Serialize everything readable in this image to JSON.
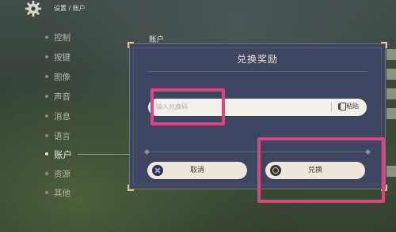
{
  "breadcrumb": "设置 / 账户",
  "menu": [
    {
      "label": "控制",
      "active": false
    },
    {
      "label": "按键",
      "active": false
    },
    {
      "label": "图像",
      "active": false
    },
    {
      "label": "声音",
      "active": false
    },
    {
      "label": "消息",
      "active": false
    },
    {
      "label": "语言",
      "active": false
    },
    {
      "label": "账户",
      "active": true
    },
    {
      "label": "资源",
      "active": false
    },
    {
      "label": "其他",
      "active": false
    }
  ],
  "section_header": "账户",
  "dialog": {
    "title": "兑换奖励",
    "input_placeholder": "输入兑换码",
    "paste_label": "粘贴",
    "cancel_label": "取消",
    "confirm_label": "兑换"
  },
  "colors": {
    "dialog_bg": "#3d4560",
    "button_bg": "#ece7da",
    "highlight": "#e0437f",
    "corner_gold": "#e2c98f"
  },
  "icons": {
    "settings": "gear-icon",
    "paste": "clipboard-icon",
    "cancel": "x-circle-icon",
    "confirm": "o-circle-icon"
  }
}
